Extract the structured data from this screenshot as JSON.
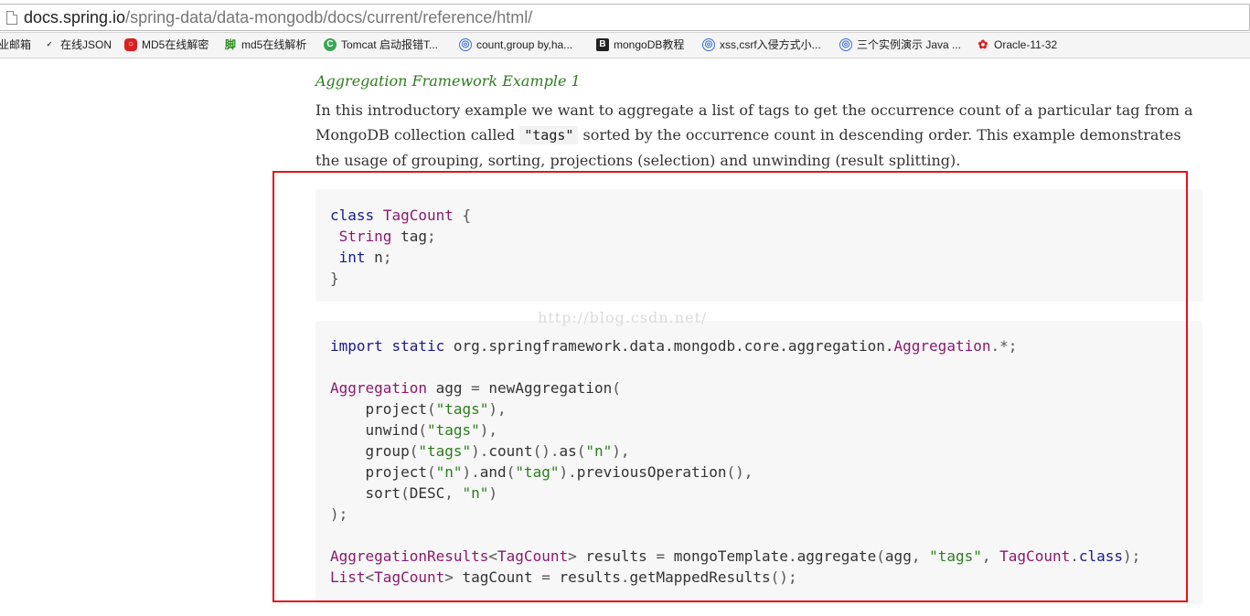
{
  "address_bar": {
    "host": "docs.spring.io",
    "path": "/spring-data/data-mongodb/docs/current/reference/html/"
  },
  "bookmarks": [
    {
      "label": "业邮箱",
      "icon": "none"
    },
    {
      "label": "在线JSON",
      "icon": "json-icon"
    },
    {
      "label": "MD5在线解密",
      "icon": "md5-icon"
    },
    {
      "label": "md5在线解析",
      "icon": "jiao-icon"
    },
    {
      "label": "Tomcat 启动报错T...",
      "icon": "c-icon"
    },
    {
      "label": "count,group by,ha...",
      "icon": "globe-icon"
    },
    {
      "label": "mongoDB教程",
      "icon": "b-icon"
    },
    {
      "label": "xss,csrf入侵方式小...",
      "icon": "globe-icon"
    },
    {
      "label": "三个实例演示 Java ...",
      "icon": "globe-icon"
    },
    {
      "label": "Oracle-11-32",
      "icon": "baidu-icon"
    }
  ],
  "article": {
    "example_title": "Aggregation Framework Example 1",
    "intro_before": "In this introductory example we want to aggregate a list of tags to get the occurrence count of a particular tag from a MongoDB collection called ",
    "intro_code": "\"tags\"",
    "intro_after": " sorted by the occurrence count in descending order. This example demonstrates the usage of grouping, sorting, projections (selection) and unwinding (result splitting)."
  },
  "watermark": "http://blog.csdn.net/",
  "code_block_1": [
    [
      {
        "t": "class",
        "c": "kw"
      },
      {
        "t": " ",
        "c": "pl"
      },
      {
        "t": "TagCount",
        "c": "ty"
      },
      {
        "t": " {",
        "c": "pn"
      }
    ],
    [
      {
        "t": " ",
        "c": "pl"
      },
      {
        "t": "String",
        "c": "ty"
      },
      {
        "t": " tag",
        "c": "pl"
      },
      {
        "t": ";",
        "c": "pn"
      }
    ],
    [
      {
        "t": " ",
        "c": "pl"
      },
      {
        "t": "int",
        "c": "kw"
      },
      {
        "t": " n",
        "c": "pl"
      },
      {
        "t": ";",
        "c": "pn"
      }
    ],
    [
      {
        "t": "}",
        "c": "pn"
      }
    ]
  ],
  "code_block_2": [
    [
      {
        "t": "import",
        "c": "kw"
      },
      {
        "t": " ",
        "c": "pl"
      },
      {
        "t": "static",
        "c": "kw"
      },
      {
        "t": " org.springframework.data.mongodb.core.aggregation.",
        "c": "pl"
      },
      {
        "t": "Aggregation",
        "c": "ty"
      },
      {
        "t": ".*;",
        "c": "pn"
      }
    ],
    [],
    [
      {
        "t": "Aggregation",
        "c": "ty"
      },
      {
        "t": " agg ",
        "c": "pl"
      },
      {
        "t": "=",
        "c": "pn"
      },
      {
        "t": " newAggregation",
        "c": "pl"
      },
      {
        "t": "(",
        "c": "pn"
      }
    ],
    [
      {
        "t": "    project",
        "c": "pl"
      },
      {
        "t": "(",
        "c": "pn"
      },
      {
        "t": "\"tags\"",
        "c": "str"
      },
      {
        "t": "),",
        "c": "pn"
      }
    ],
    [
      {
        "t": "    unwind",
        "c": "pl"
      },
      {
        "t": "(",
        "c": "pn"
      },
      {
        "t": "\"tags\"",
        "c": "str"
      },
      {
        "t": "),",
        "c": "pn"
      }
    ],
    [
      {
        "t": "    group",
        "c": "pl"
      },
      {
        "t": "(",
        "c": "pn"
      },
      {
        "t": "\"tags\"",
        "c": "str"
      },
      {
        "t": ").",
        "c": "pn"
      },
      {
        "t": "count",
        "c": "pl"
      },
      {
        "t": "().",
        "c": "pn"
      },
      {
        "t": "as",
        "c": "pl"
      },
      {
        "t": "(",
        "c": "pn"
      },
      {
        "t": "\"n\"",
        "c": "str"
      },
      {
        "t": "),",
        "c": "pn"
      }
    ],
    [
      {
        "t": "    project",
        "c": "pl"
      },
      {
        "t": "(",
        "c": "pn"
      },
      {
        "t": "\"n\"",
        "c": "str"
      },
      {
        "t": ").",
        "c": "pn"
      },
      {
        "t": "and",
        "c": "pl"
      },
      {
        "t": "(",
        "c": "pn"
      },
      {
        "t": "\"tag\"",
        "c": "str"
      },
      {
        "t": ").",
        "c": "pn"
      },
      {
        "t": "previousOperation",
        "c": "pl"
      },
      {
        "t": "(),",
        "c": "pn"
      }
    ],
    [
      {
        "t": "    sort",
        "c": "pl"
      },
      {
        "t": "(",
        "c": "pn"
      },
      {
        "t": "DESC",
        "c": "pl"
      },
      {
        "t": ", ",
        "c": "pn"
      },
      {
        "t": "\"n\"",
        "c": "str"
      },
      {
        "t": ")",
        "c": "pn"
      }
    ],
    [
      {
        "t": ");",
        "c": "pn"
      }
    ],
    [],
    [
      {
        "t": "AggregationResults",
        "c": "ty"
      },
      {
        "t": "<",
        "c": "pn"
      },
      {
        "t": "TagCount",
        "c": "ty"
      },
      {
        "t": ">",
        "c": "pn"
      },
      {
        "t": " results ",
        "c": "pl"
      },
      {
        "t": "=",
        "c": "pn"
      },
      {
        "t": " mongoTemplate",
        "c": "pl"
      },
      {
        "t": ".",
        "c": "pn"
      },
      {
        "t": "aggregate",
        "c": "pl"
      },
      {
        "t": "(",
        "c": "pn"
      },
      {
        "t": "agg",
        "c": "pl"
      },
      {
        "t": ", ",
        "c": "pn"
      },
      {
        "t": "\"tags\"",
        "c": "str"
      },
      {
        "t": ", ",
        "c": "pn"
      },
      {
        "t": "TagCount",
        "c": "ty"
      },
      {
        "t": ".",
        "c": "pn"
      },
      {
        "t": "class",
        "c": "kw"
      },
      {
        "t": ");",
        "c": "pn"
      }
    ],
    [
      {
        "t": "List",
        "c": "ty"
      },
      {
        "t": "<",
        "c": "pn"
      },
      {
        "t": "TagCount",
        "c": "ty"
      },
      {
        "t": ">",
        "c": "pn"
      },
      {
        "t": " tagCount ",
        "c": "pl"
      },
      {
        "t": "=",
        "c": "pn"
      },
      {
        "t": " results",
        "c": "pl"
      },
      {
        "t": ".",
        "c": "pn"
      },
      {
        "t": "getMappedResults",
        "c": "pl"
      },
      {
        "t": "();",
        "c": "pn"
      }
    ]
  ],
  "colors": {
    "keyword": "#1a1a8c",
    "type": "#8a1a6e",
    "string": "#2e7d1e",
    "highlight_border": "#e3151a",
    "code_background": "#f7f7f7"
  }
}
